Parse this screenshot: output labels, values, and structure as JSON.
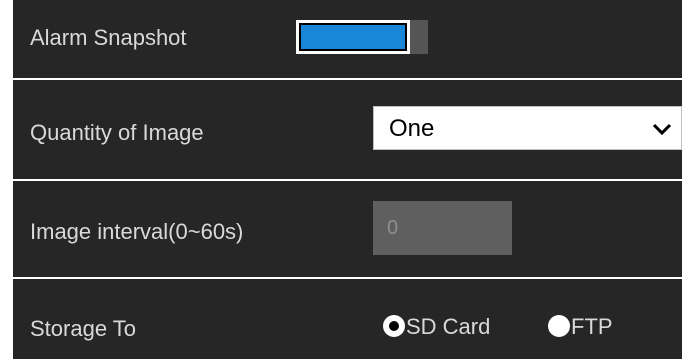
{
  "alarm_snapshot": {
    "label": "Alarm Snapshot",
    "enabled": true,
    "accent_color": "#1a86d8"
  },
  "quantity_of_image": {
    "label": "Quantity of Image",
    "selected": "One",
    "icon": "chevron-down-icon"
  },
  "image_interval": {
    "label": "Image interval(0~60s)",
    "value": "0"
  },
  "storage_to": {
    "label": "Storage To",
    "options": [
      {
        "label": "SD Card",
        "checked": true
      },
      {
        "label": "FTP",
        "checked": false
      }
    ]
  }
}
